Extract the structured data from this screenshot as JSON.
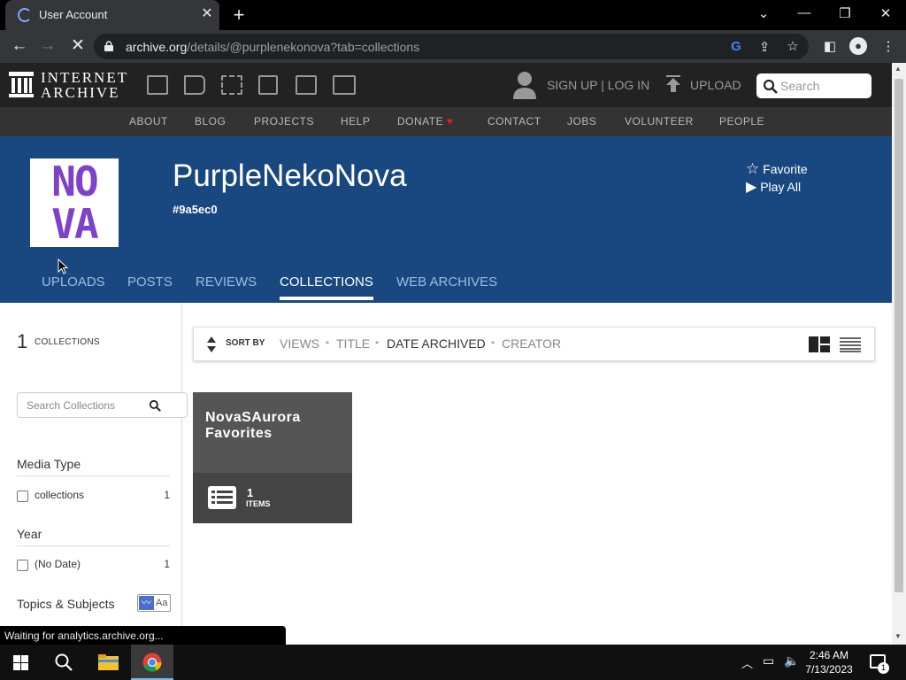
{
  "browser": {
    "tab_title": "User Account",
    "new_tab_symbol": "+",
    "url_host": "archive.org",
    "url_path": "/details/@purplenekonova?tab=collections"
  },
  "ia_header": {
    "logo_line1": "INTERNET",
    "logo_line2": "ARCHIVE",
    "signin_label": "SIGN UP | LOG IN",
    "upload_label": "UPLOAD",
    "search_placeholder": "Search"
  },
  "subnav": [
    "ABOUT",
    "BLOG",
    "PROJECTS",
    "HELP",
    "DONATE",
    "CONTACT",
    "JOBS",
    "VOLUNTEER",
    "PEOPLE"
  ],
  "profile": {
    "avatar_text": [
      "NO",
      "VA"
    ],
    "username": "PurpleNekoNova",
    "user_id": "#9a5ec0",
    "favorite_label": "Favorite",
    "play_all_label": "Play All",
    "tabs": [
      "UPLOADS",
      "POSTS",
      "REVIEWS",
      "COLLECTIONS",
      "WEB ARCHIVES"
    ],
    "active_tab": "COLLECTIONS"
  },
  "sidebar": {
    "count": "1",
    "count_label": "COLLECTIONS",
    "search_placeholder": "Search Collections",
    "facets": [
      {
        "heading": "Media Type",
        "rows": [
          {
            "label": "collections",
            "count": "1"
          }
        ]
      },
      {
        "heading": "Year",
        "rows": [
          {
            "label": "(No Date)",
            "count": "1"
          }
        ]
      },
      {
        "heading": "Topics & Subjects",
        "rows": []
      }
    ],
    "topics_toggle_text": "Aa"
  },
  "sortbar": {
    "label": "SORT BY",
    "options": [
      "VIEWS",
      "TITLE",
      "DATE ARCHIVED",
      "CREATOR"
    ],
    "selected": "DATE ARCHIVED"
  },
  "tile": {
    "title_line1": "NovaSAurora",
    "title_line2": "Favorites",
    "item_count": "1",
    "item_unit": "ITEMS"
  },
  "status_text": "Waiting for analytics.archive.org...",
  "taskbar": {
    "time": "2:46 AM",
    "date": "7/13/2023",
    "notification_count": "1"
  },
  "colors": {
    "banner": "#194880",
    "avatar_purple": "#7e42c8",
    "ia_header": "#222222"
  }
}
